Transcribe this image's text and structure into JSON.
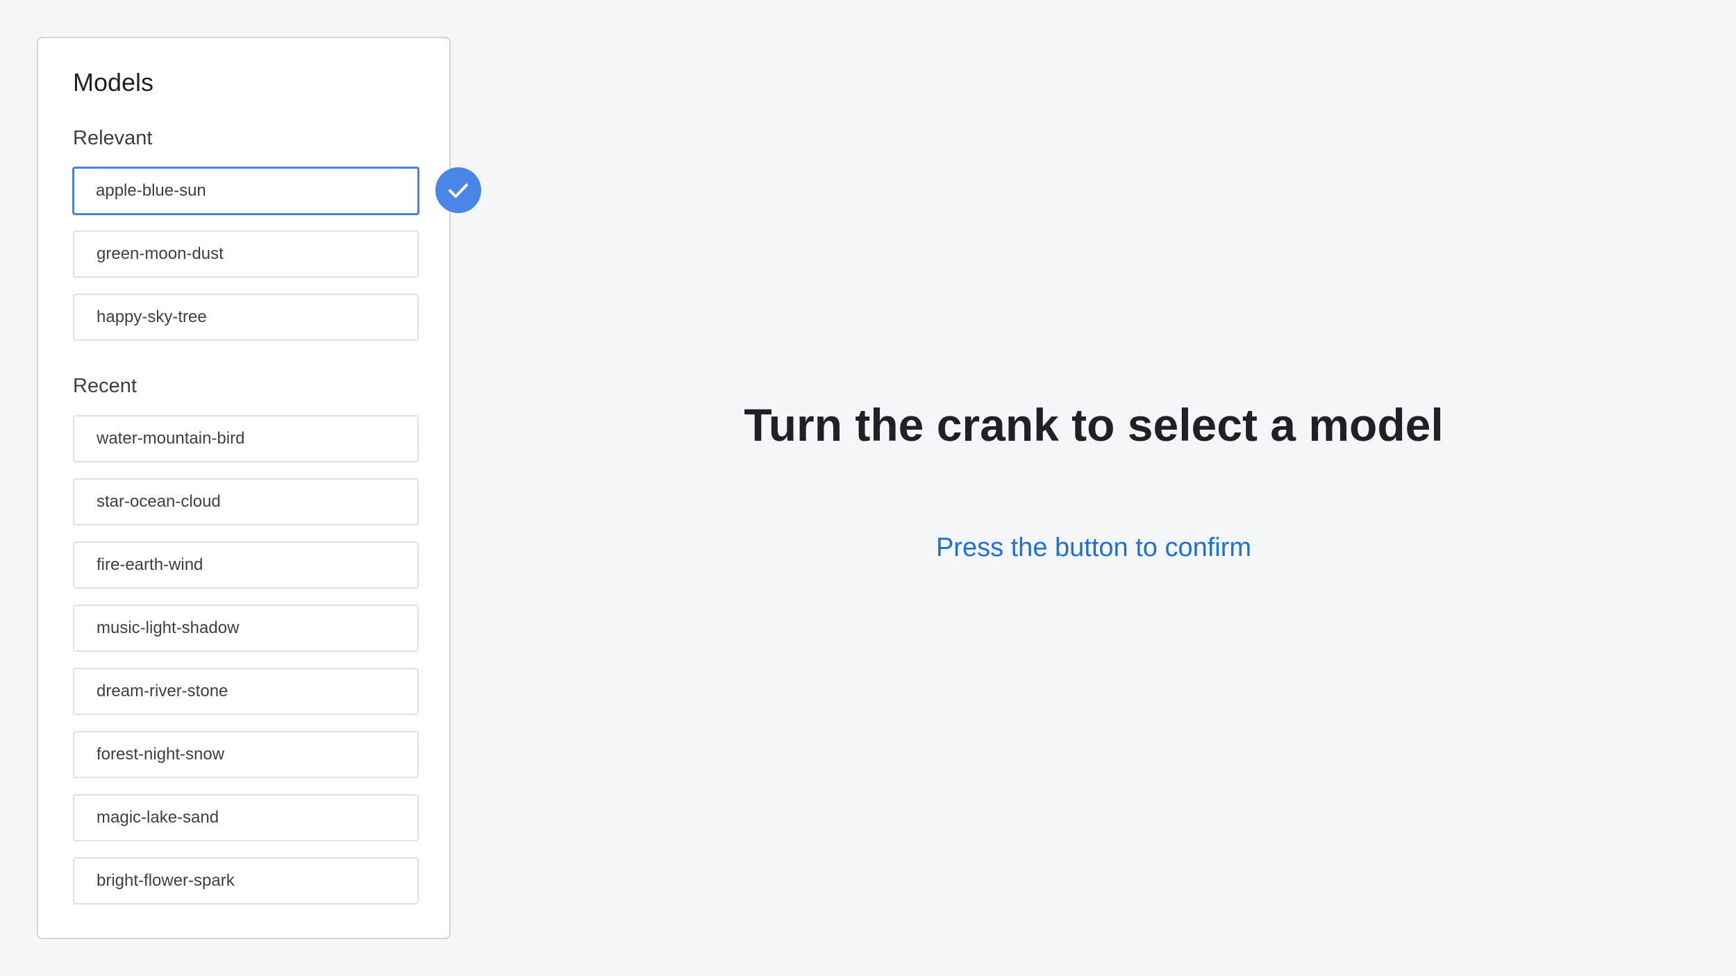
{
  "panel": {
    "title": "Models",
    "sections": {
      "relevant": {
        "label": "Relevant",
        "items": [
          "apple-blue-sun",
          "green-moon-dust",
          "happy-sky-tree"
        ]
      },
      "recent": {
        "label": "Recent",
        "items": [
          "water-mountain-bird",
          "star-ocean-cloud",
          "fire-earth-wind",
          "music-light-shadow",
          "dream-river-stone",
          "forest-night-snow",
          "magic-lake-sand",
          "bright-flower-spark"
        ]
      }
    },
    "selected_model": "apple-blue-sun",
    "selected_icon": "check-icon"
  },
  "main": {
    "headline": "Turn the crank to select a model",
    "instruction": "Press the button to confirm"
  },
  "colors": {
    "background": "#f5f6f8",
    "accent": "#4a86e8",
    "selected_border": "#4a80df",
    "instruction_text": "#1f6fd6"
  }
}
